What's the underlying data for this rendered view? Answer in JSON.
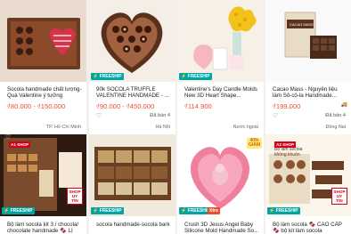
{
  "products": [
    {
      "title": "Socola handmade chất lượng- Quà Valentine ý tưởng",
      "price": "₫80.000 - ₫150.000",
      "sold": "",
      "location": "TP. Hồ Chí Minh",
      "freeship": false
    },
    {
      "title": "90k SOCOLA TRUFFLE VALENTINE HANDMADE - ...",
      "price": "₫90.000 - ₫450.000",
      "sold": "Đã bán 4",
      "location": "Hà Nội",
      "freeship": true
    },
    {
      "title": "Valentine's Day Candle Molds New 3D Heart Shape...",
      "price": "₫114.900",
      "sold": "",
      "location": "Nước ngoài",
      "freeship": true
    },
    {
      "title": "Cacao Mass - Nguyên liệu làm Sô-cô-la Handmade...",
      "price": "₫199.000",
      "sold": "Đã bán 4",
      "location": "Đồng Nai",
      "freeship": false
    },
    {
      "title": "Bộ làm socola kit 3 / chocola/ chocolate handmade 🍫 LỊ",
      "price": "",
      "sold": "",
      "location": "",
      "freeship": true
    },
    {
      "title": "socola handmade-socola bark",
      "price": "",
      "sold": "",
      "location": "",
      "freeship": true
    },
    {
      "title": "Crush 3D Jesus Angel Baby Silicone Mold Handmade So...",
      "price": "",
      "sold": "",
      "location": "",
      "freeship": true
    },
    {
      "title": "Bộ làm socola 🍫 CAO CẤP 🍫 bộ kit làm socola",
      "price": "",
      "sold": "",
      "location": "",
      "freeship": true
    }
  ],
  "labels": {
    "freeship": "FREESHIP",
    "freeship_icon": "⚡",
    "xtra": "Xtra",
    "shop_uy_tin_1": "SHOP",
    "shop_uy_tin_2": "UY TÍN",
    "giam": "40%",
    "giam2": "GIẢM",
    "heart_icon": "♡",
    "truck_icon": "🚚",
    "shop_ribbon": "A1 SHOP",
    "shop_ribbon2": "A2 SHOP",
    "banner_text": "Bộ làm socola không khuôn",
    "cacao_pkg": "CACAO MASS"
  },
  "colors": {
    "price": "#ee4d2d",
    "freeship": "#00a6a6",
    "ribbon": "#d0011b"
  }
}
